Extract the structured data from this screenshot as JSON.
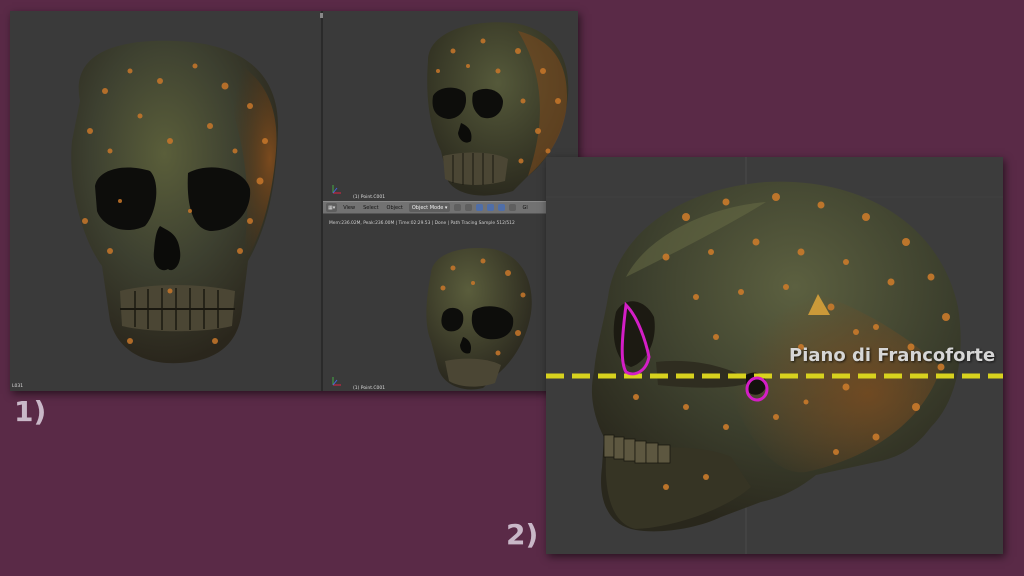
{
  "labels": {
    "one": "1)",
    "two": "2)"
  },
  "panel1": {
    "left_viewport": {
      "corner_label": "L031"
    },
    "top_right_viewport": {
      "object_label": "(1) Point.C001"
    },
    "bottom_right_viewport": {
      "object_label": "(1) Point.C001"
    },
    "toolbar": {
      "menu_view": "View",
      "menu_select": "Select",
      "menu_object": "Object",
      "mode": "Object Mode",
      "trailing": "Gl"
    },
    "status_text": "Mem:236.02M, Peak:236.00M | Time:02:29.53 | Done | Path Tracing Sample 512/512"
  },
  "panel2": {
    "plane_label": "Piano di Francoforte",
    "plane_color": "#d8d21e",
    "marker_color": "#d41ec6"
  }
}
